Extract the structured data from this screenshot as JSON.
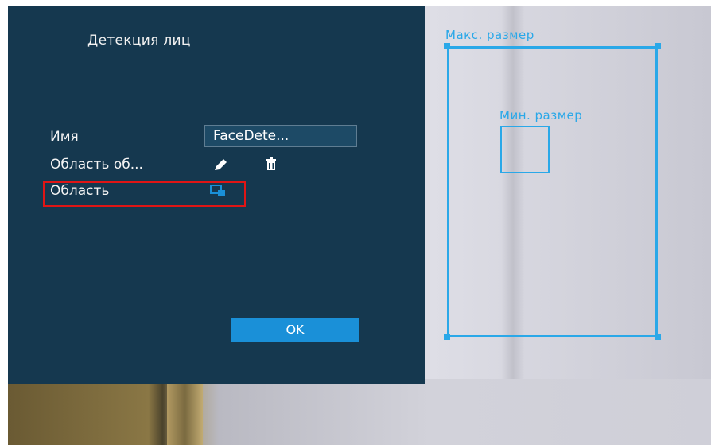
{
  "dialog": {
    "title": "Детекция лиц",
    "rows": {
      "name_label": "Имя",
      "name_value": "FaceDete...",
      "detect_area_label": "Область об...",
      "area_label": "Область"
    },
    "ok_label": "OK"
  },
  "overlay": {
    "max_size_label": "Макс. размер",
    "min_size_label": "Мин. размер"
  },
  "icons": {
    "edit": "pencil-icon",
    "delete": "trash-icon",
    "area": "region-icon"
  },
  "colors": {
    "panel_bg": "#15384f",
    "accent": "#1a90d8",
    "region": "#2aa8e8",
    "highlight": "#e01515"
  }
}
